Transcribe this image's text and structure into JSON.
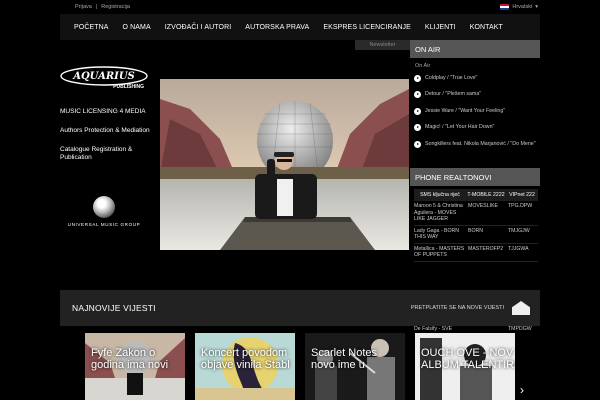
{
  "topbar": {
    "links": [
      "Prijava",
      "Registracija"
    ],
    "language": "Hrvatski"
  },
  "nav": {
    "items": [
      "POČETNA",
      "O NAMA",
      "IZVOĐAČI I AUTORI",
      "AUTORSKA PRAVA",
      "EKSPRES LICENCIRANJE",
      "KLIJENTI",
      "KONTAKT"
    ]
  },
  "newsletter": "Newsletter",
  "logo": {
    "text": "AQUARIUS",
    "sub": "PUBLISHING"
  },
  "left_menu": [
    "MUSIC LICENSING 4 MEDIA",
    "Authors Protection & Mediation",
    "Catalogue Registration & Publication"
  ],
  "universal": {
    "text": "UNIVERSAL MUSIC GROUP"
  },
  "on_air": {
    "title": "ON AIR",
    "label": "On Air",
    "songs": [
      "Coldplay / \"True Love\"",
      "Detour / \"Plešem sama\"",
      "Jessie Ware / \"Want Your Feeling\"",
      "Magic! / \"Let Your Hair Down\"",
      "Songkillers feat. Nikola Marjanović / \"Do Mene\""
    ]
  },
  "ringtones": {
    "title": "PHONE REALTONOVI",
    "headers": [
      "SMS ključna riječ",
      "T-MOBILE 2222",
      "VIPnet 222"
    ],
    "rows": [
      [
        "Maroon 5 & Christina Aguilera - MOVES LIKE JAGGER",
        "MOVESLIKE",
        "TPG.DPW"
      ],
      [
        "Lady Gaga - BORN THIS WAY",
        "BORN",
        "TMJGJW"
      ],
      [
        "Metallica - MASTERS OF PUPPETS",
        "MASTEROFP2",
        "TJJGWA"
      ]
    ],
    "partial": [
      "De Falsify - SVE",
      "",
      "TMPDGW"
    ]
  },
  "news": {
    "title": "NAJNOVIJE VIJESTI",
    "subscribe": "PRETPLATITE SE NA NOVE VIJESTI"
  },
  "thumbs": [
    "Fyfe Zakon o",
    "Koncert povodom",
    "Scarlet Notes",
    "OUCH OVE - NOV"
  ],
  "thumbs_line2": [
    "godina ima novi",
    "objave vinila Stabl",
    "novo ime u",
    "ALBUM TALENTIRAN"
  ]
}
